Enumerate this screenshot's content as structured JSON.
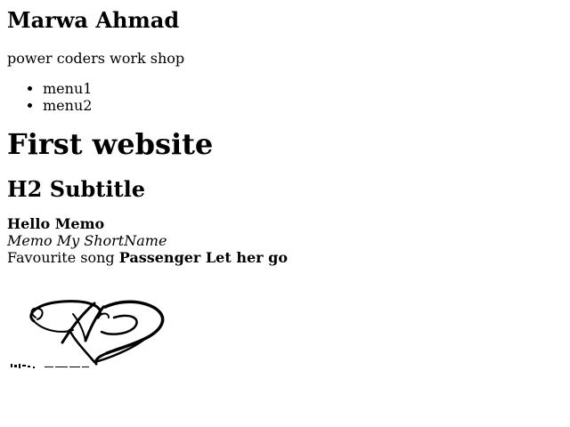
{
  "header": {
    "name": "Marwa Ahmad",
    "tagline": "power coders work shop"
  },
  "menu": {
    "items": [
      "menu1",
      "menu2"
    ]
  },
  "main": {
    "title": "First website",
    "subtitle": "H2 Subtitle",
    "greeting": "Hello Memo",
    "short_name": "Memo My ShortName",
    "song_label": "Favourite song",
    "song_title": "Passenger Let her go"
  },
  "logo": {
    "icon": "monogram-heart-logo",
    "color": "#000000"
  }
}
